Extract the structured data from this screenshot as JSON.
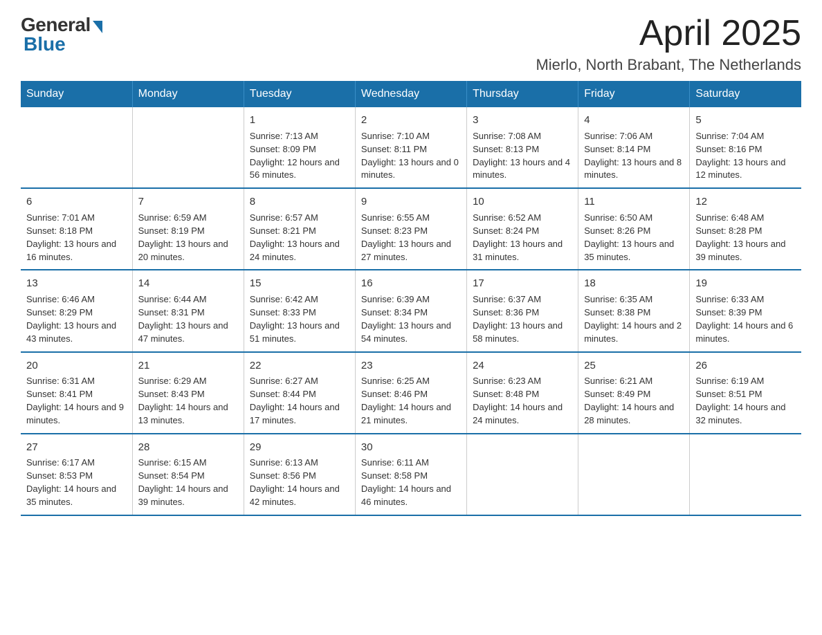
{
  "logo": {
    "general": "General",
    "blue": "Blue"
  },
  "header": {
    "month_year": "April 2025",
    "location": "Mierlo, North Brabant, The Netherlands"
  },
  "days_of_week": [
    "Sunday",
    "Monday",
    "Tuesday",
    "Wednesday",
    "Thursday",
    "Friday",
    "Saturday"
  ],
  "weeks": [
    [
      {
        "day": "",
        "sunrise": "",
        "sunset": "",
        "daylight": ""
      },
      {
        "day": "",
        "sunrise": "",
        "sunset": "",
        "daylight": ""
      },
      {
        "day": "1",
        "sunrise": "Sunrise: 7:13 AM",
        "sunset": "Sunset: 8:09 PM",
        "daylight": "Daylight: 12 hours and 56 minutes."
      },
      {
        "day": "2",
        "sunrise": "Sunrise: 7:10 AM",
        "sunset": "Sunset: 8:11 PM",
        "daylight": "Daylight: 13 hours and 0 minutes."
      },
      {
        "day": "3",
        "sunrise": "Sunrise: 7:08 AM",
        "sunset": "Sunset: 8:13 PM",
        "daylight": "Daylight: 13 hours and 4 minutes."
      },
      {
        "day": "4",
        "sunrise": "Sunrise: 7:06 AM",
        "sunset": "Sunset: 8:14 PM",
        "daylight": "Daylight: 13 hours and 8 minutes."
      },
      {
        "day": "5",
        "sunrise": "Sunrise: 7:04 AM",
        "sunset": "Sunset: 8:16 PM",
        "daylight": "Daylight: 13 hours and 12 minutes."
      }
    ],
    [
      {
        "day": "6",
        "sunrise": "Sunrise: 7:01 AM",
        "sunset": "Sunset: 8:18 PM",
        "daylight": "Daylight: 13 hours and 16 minutes."
      },
      {
        "day": "7",
        "sunrise": "Sunrise: 6:59 AM",
        "sunset": "Sunset: 8:19 PM",
        "daylight": "Daylight: 13 hours and 20 minutes."
      },
      {
        "day": "8",
        "sunrise": "Sunrise: 6:57 AM",
        "sunset": "Sunset: 8:21 PM",
        "daylight": "Daylight: 13 hours and 24 minutes."
      },
      {
        "day": "9",
        "sunrise": "Sunrise: 6:55 AM",
        "sunset": "Sunset: 8:23 PM",
        "daylight": "Daylight: 13 hours and 27 minutes."
      },
      {
        "day": "10",
        "sunrise": "Sunrise: 6:52 AM",
        "sunset": "Sunset: 8:24 PM",
        "daylight": "Daylight: 13 hours and 31 minutes."
      },
      {
        "day": "11",
        "sunrise": "Sunrise: 6:50 AM",
        "sunset": "Sunset: 8:26 PM",
        "daylight": "Daylight: 13 hours and 35 minutes."
      },
      {
        "day": "12",
        "sunrise": "Sunrise: 6:48 AM",
        "sunset": "Sunset: 8:28 PM",
        "daylight": "Daylight: 13 hours and 39 minutes."
      }
    ],
    [
      {
        "day": "13",
        "sunrise": "Sunrise: 6:46 AM",
        "sunset": "Sunset: 8:29 PM",
        "daylight": "Daylight: 13 hours and 43 minutes."
      },
      {
        "day": "14",
        "sunrise": "Sunrise: 6:44 AM",
        "sunset": "Sunset: 8:31 PM",
        "daylight": "Daylight: 13 hours and 47 minutes."
      },
      {
        "day": "15",
        "sunrise": "Sunrise: 6:42 AM",
        "sunset": "Sunset: 8:33 PM",
        "daylight": "Daylight: 13 hours and 51 minutes."
      },
      {
        "day": "16",
        "sunrise": "Sunrise: 6:39 AM",
        "sunset": "Sunset: 8:34 PM",
        "daylight": "Daylight: 13 hours and 54 minutes."
      },
      {
        "day": "17",
        "sunrise": "Sunrise: 6:37 AM",
        "sunset": "Sunset: 8:36 PM",
        "daylight": "Daylight: 13 hours and 58 minutes."
      },
      {
        "day": "18",
        "sunrise": "Sunrise: 6:35 AM",
        "sunset": "Sunset: 8:38 PM",
        "daylight": "Daylight: 14 hours and 2 minutes."
      },
      {
        "day": "19",
        "sunrise": "Sunrise: 6:33 AM",
        "sunset": "Sunset: 8:39 PM",
        "daylight": "Daylight: 14 hours and 6 minutes."
      }
    ],
    [
      {
        "day": "20",
        "sunrise": "Sunrise: 6:31 AM",
        "sunset": "Sunset: 8:41 PM",
        "daylight": "Daylight: 14 hours and 9 minutes."
      },
      {
        "day": "21",
        "sunrise": "Sunrise: 6:29 AM",
        "sunset": "Sunset: 8:43 PM",
        "daylight": "Daylight: 14 hours and 13 minutes."
      },
      {
        "day": "22",
        "sunrise": "Sunrise: 6:27 AM",
        "sunset": "Sunset: 8:44 PM",
        "daylight": "Daylight: 14 hours and 17 minutes."
      },
      {
        "day": "23",
        "sunrise": "Sunrise: 6:25 AM",
        "sunset": "Sunset: 8:46 PM",
        "daylight": "Daylight: 14 hours and 21 minutes."
      },
      {
        "day": "24",
        "sunrise": "Sunrise: 6:23 AM",
        "sunset": "Sunset: 8:48 PM",
        "daylight": "Daylight: 14 hours and 24 minutes."
      },
      {
        "day": "25",
        "sunrise": "Sunrise: 6:21 AM",
        "sunset": "Sunset: 8:49 PM",
        "daylight": "Daylight: 14 hours and 28 minutes."
      },
      {
        "day": "26",
        "sunrise": "Sunrise: 6:19 AM",
        "sunset": "Sunset: 8:51 PM",
        "daylight": "Daylight: 14 hours and 32 minutes."
      }
    ],
    [
      {
        "day": "27",
        "sunrise": "Sunrise: 6:17 AM",
        "sunset": "Sunset: 8:53 PM",
        "daylight": "Daylight: 14 hours and 35 minutes."
      },
      {
        "day": "28",
        "sunrise": "Sunrise: 6:15 AM",
        "sunset": "Sunset: 8:54 PM",
        "daylight": "Daylight: 14 hours and 39 minutes."
      },
      {
        "day": "29",
        "sunrise": "Sunrise: 6:13 AM",
        "sunset": "Sunset: 8:56 PM",
        "daylight": "Daylight: 14 hours and 42 minutes."
      },
      {
        "day": "30",
        "sunrise": "Sunrise: 6:11 AM",
        "sunset": "Sunset: 8:58 PM",
        "daylight": "Daylight: 14 hours and 46 minutes."
      },
      {
        "day": "",
        "sunrise": "",
        "sunset": "",
        "daylight": ""
      },
      {
        "day": "",
        "sunrise": "",
        "sunset": "",
        "daylight": ""
      },
      {
        "day": "",
        "sunrise": "",
        "sunset": "",
        "daylight": ""
      }
    ]
  ]
}
